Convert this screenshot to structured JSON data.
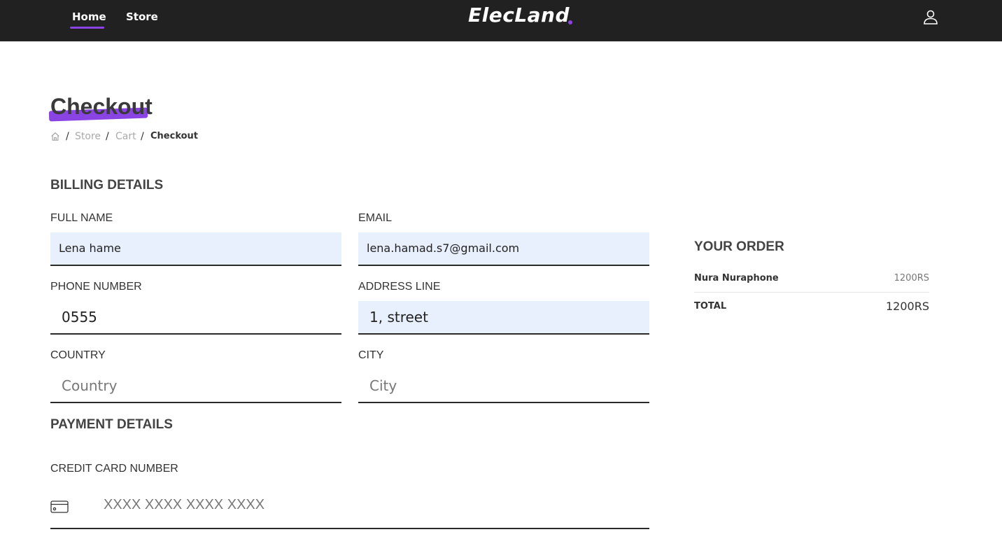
{
  "nav": {
    "home_label": "Home",
    "store_label": "Store",
    "active_indicator_color": "#8b44e4",
    "user_icon": "user-icon"
  },
  "brand": {
    "name": "ElecLand",
    "dot_color": "#8b44e4"
  },
  "page": {
    "title": "Checkout",
    "brush_color": "#8b44e4"
  },
  "breadcrumb": {
    "home_icon": "home-icon",
    "separator": "/",
    "items": [
      "Store",
      "Cart"
    ],
    "current": "Checkout"
  },
  "billing": {
    "title": "BILLING DETAILS",
    "full_name": {
      "label": "FULL NAME",
      "value": "Lena hame"
    },
    "email": {
      "label": "EMAIL",
      "value": "lena.hamad.s7@gmail.com"
    },
    "phone": {
      "label": "PHONE NUMBER",
      "value": "0555"
    },
    "address": {
      "label": "ADDRESS LINE",
      "value": "1, street"
    },
    "country": {
      "label": "COUNTRY",
      "placeholder": "Country"
    },
    "city": {
      "label": "CITY",
      "placeholder": "City"
    }
  },
  "payment": {
    "title": "PAYMENT DETAILS",
    "card": {
      "label": "CREDIT CARD NUMBER",
      "placeholder": "XXXX XXXX XXXX XXXX",
      "icon": "credit-card-icon"
    }
  },
  "order": {
    "title": "YOUR ORDER",
    "items": [
      {
        "name": "Nura Nuraphone",
        "price": "1200RS"
      }
    ],
    "total_label": "TOTAL",
    "total_value": "1200RS"
  }
}
